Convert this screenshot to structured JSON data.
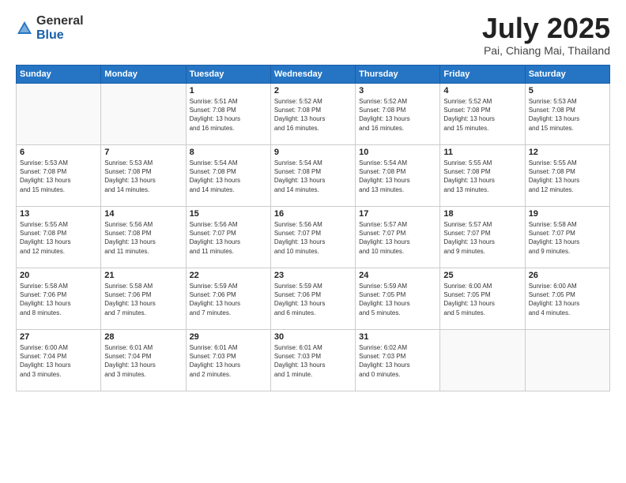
{
  "logo": {
    "general": "General",
    "blue": "Blue"
  },
  "header": {
    "month": "July 2025",
    "location": "Pai, Chiang Mai, Thailand"
  },
  "weekdays": [
    "Sunday",
    "Monday",
    "Tuesday",
    "Wednesday",
    "Thursday",
    "Friday",
    "Saturday"
  ],
  "weeks": [
    [
      {
        "day": "",
        "detail": ""
      },
      {
        "day": "",
        "detail": ""
      },
      {
        "day": "1",
        "detail": "Sunrise: 5:51 AM\nSunset: 7:08 PM\nDaylight: 13 hours\nand 16 minutes."
      },
      {
        "day": "2",
        "detail": "Sunrise: 5:52 AM\nSunset: 7:08 PM\nDaylight: 13 hours\nand 16 minutes."
      },
      {
        "day": "3",
        "detail": "Sunrise: 5:52 AM\nSunset: 7:08 PM\nDaylight: 13 hours\nand 16 minutes."
      },
      {
        "day": "4",
        "detail": "Sunrise: 5:52 AM\nSunset: 7:08 PM\nDaylight: 13 hours\nand 15 minutes."
      },
      {
        "day": "5",
        "detail": "Sunrise: 5:53 AM\nSunset: 7:08 PM\nDaylight: 13 hours\nand 15 minutes."
      }
    ],
    [
      {
        "day": "6",
        "detail": "Sunrise: 5:53 AM\nSunset: 7:08 PM\nDaylight: 13 hours\nand 15 minutes."
      },
      {
        "day": "7",
        "detail": "Sunrise: 5:53 AM\nSunset: 7:08 PM\nDaylight: 13 hours\nand 14 minutes."
      },
      {
        "day": "8",
        "detail": "Sunrise: 5:54 AM\nSunset: 7:08 PM\nDaylight: 13 hours\nand 14 minutes."
      },
      {
        "day": "9",
        "detail": "Sunrise: 5:54 AM\nSunset: 7:08 PM\nDaylight: 13 hours\nand 14 minutes."
      },
      {
        "day": "10",
        "detail": "Sunrise: 5:54 AM\nSunset: 7:08 PM\nDaylight: 13 hours\nand 13 minutes."
      },
      {
        "day": "11",
        "detail": "Sunrise: 5:55 AM\nSunset: 7:08 PM\nDaylight: 13 hours\nand 13 minutes."
      },
      {
        "day": "12",
        "detail": "Sunrise: 5:55 AM\nSunset: 7:08 PM\nDaylight: 13 hours\nand 12 minutes."
      }
    ],
    [
      {
        "day": "13",
        "detail": "Sunrise: 5:55 AM\nSunset: 7:08 PM\nDaylight: 13 hours\nand 12 minutes."
      },
      {
        "day": "14",
        "detail": "Sunrise: 5:56 AM\nSunset: 7:08 PM\nDaylight: 13 hours\nand 11 minutes."
      },
      {
        "day": "15",
        "detail": "Sunrise: 5:56 AM\nSunset: 7:07 PM\nDaylight: 13 hours\nand 11 minutes."
      },
      {
        "day": "16",
        "detail": "Sunrise: 5:56 AM\nSunset: 7:07 PM\nDaylight: 13 hours\nand 10 minutes."
      },
      {
        "day": "17",
        "detail": "Sunrise: 5:57 AM\nSunset: 7:07 PM\nDaylight: 13 hours\nand 10 minutes."
      },
      {
        "day": "18",
        "detail": "Sunrise: 5:57 AM\nSunset: 7:07 PM\nDaylight: 13 hours\nand 9 minutes."
      },
      {
        "day": "19",
        "detail": "Sunrise: 5:58 AM\nSunset: 7:07 PM\nDaylight: 13 hours\nand 9 minutes."
      }
    ],
    [
      {
        "day": "20",
        "detail": "Sunrise: 5:58 AM\nSunset: 7:06 PM\nDaylight: 13 hours\nand 8 minutes."
      },
      {
        "day": "21",
        "detail": "Sunrise: 5:58 AM\nSunset: 7:06 PM\nDaylight: 13 hours\nand 7 minutes."
      },
      {
        "day": "22",
        "detail": "Sunrise: 5:59 AM\nSunset: 7:06 PM\nDaylight: 13 hours\nand 7 minutes."
      },
      {
        "day": "23",
        "detail": "Sunrise: 5:59 AM\nSunset: 7:06 PM\nDaylight: 13 hours\nand 6 minutes."
      },
      {
        "day": "24",
        "detail": "Sunrise: 5:59 AM\nSunset: 7:05 PM\nDaylight: 13 hours\nand 5 minutes."
      },
      {
        "day": "25",
        "detail": "Sunrise: 6:00 AM\nSunset: 7:05 PM\nDaylight: 13 hours\nand 5 minutes."
      },
      {
        "day": "26",
        "detail": "Sunrise: 6:00 AM\nSunset: 7:05 PM\nDaylight: 13 hours\nand 4 minutes."
      }
    ],
    [
      {
        "day": "27",
        "detail": "Sunrise: 6:00 AM\nSunset: 7:04 PM\nDaylight: 13 hours\nand 3 minutes."
      },
      {
        "day": "28",
        "detail": "Sunrise: 6:01 AM\nSunset: 7:04 PM\nDaylight: 13 hours\nand 3 minutes."
      },
      {
        "day": "29",
        "detail": "Sunrise: 6:01 AM\nSunset: 7:03 PM\nDaylight: 13 hours\nand 2 minutes."
      },
      {
        "day": "30",
        "detail": "Sunrise: 6:01 AM\nSunset: 7:03 PM\nDaylight: 13 hours\nand 1 minute."
      },
      {
        "day": "31",
        "detail": "Sunrise: 6:02 AM\nSunset: 7:03 PM\nDaylight: 13 hours\nand 0 minutes."
      },
      {
        "day": "",
        "detail": ""
      },
      {
        "day": "",
        "detail": ""
      }
    ]
  ]
}
